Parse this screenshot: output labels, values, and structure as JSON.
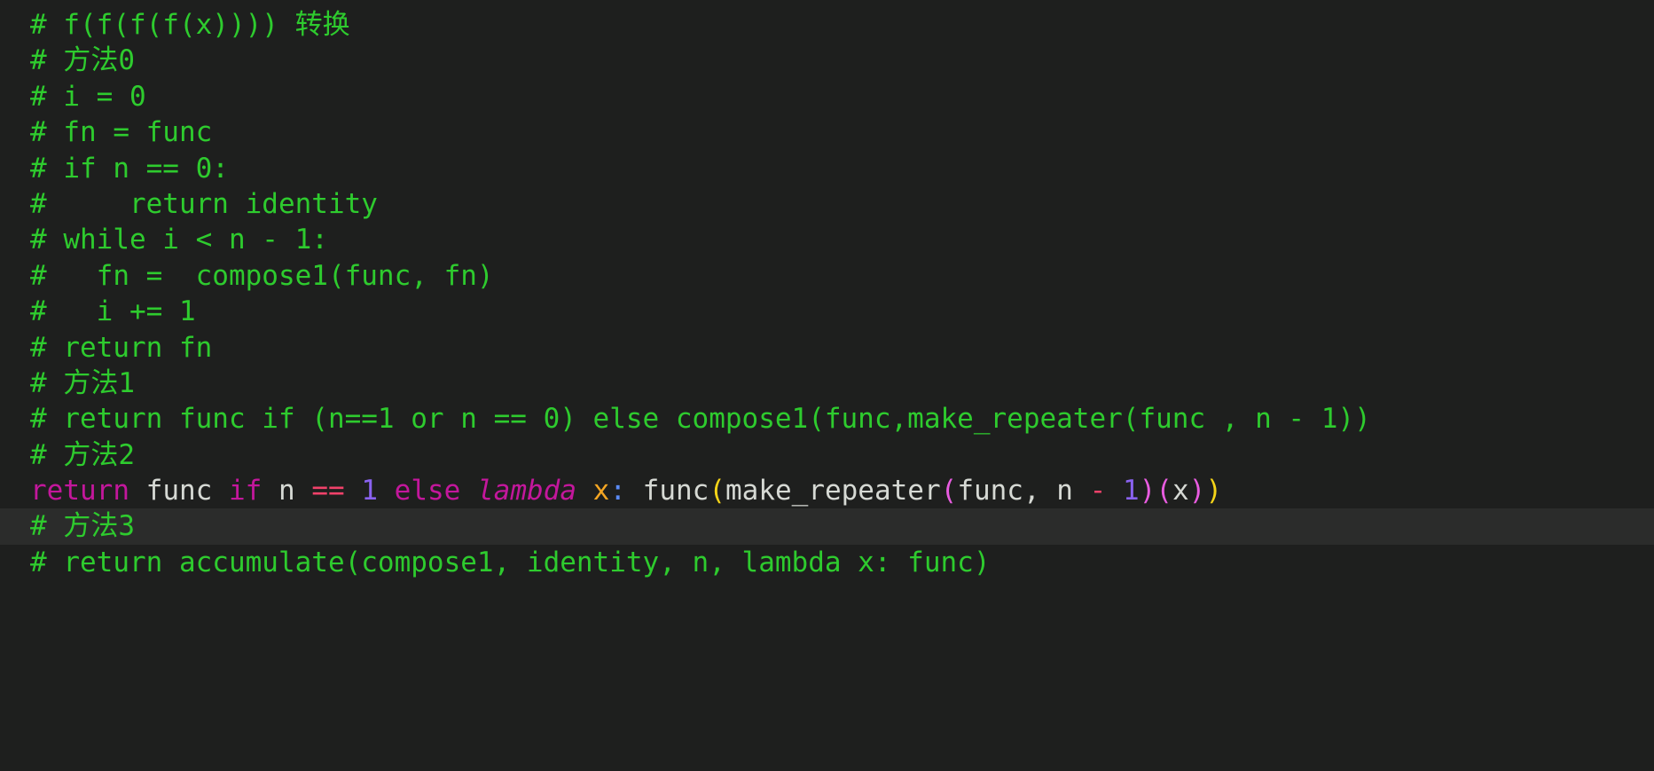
{
  "editor": {
    "background_color": "#1e1f1e",
    "active_line_color": "#2b2c2b",
    "comment_color": "#2ecb2e",
    "keyword_color": "#c3179c",
    "plain_color": "#d6d9d4",
    "operator_color": "#f1426a",
    "number_color": "#8a62f0",
    "param_color": "#f5a623",
    "colon_color": "#5b8bf7",
    "bracket_yellow": "#f5d418",
    "bracket_magenta": "#e85ce0"
  },
  "lines": [
    {
      "id": 1,
      "text": "# f(f(f(f(x)))) 转换",
      "kind": "comment",
      "active": false
    },
    {
      "id": 2,
      "text": "# 方法0",
      "kind": "comment",
      "active": false
    },
    {
      "id": 3,
      "text": "# i = 0",
      "kind": "comment",
      "active": false
    },
    {
      "id": 4,
      "text": "# fn = func",
      "kind": "comment",
      "active": false
    },
    {
      "id": 5,
      "text": "# if n == 0:",
      "kind": "comment",
      "active": false
    },
    {
      "id": 6,
      "text": "#     return identity",
      "kind": "comment",
      "active": false
    },
    {
      "id": 7,
      "text": "# while i < n - 1:",
      "kind": "comment",
      "active": false
    },
    {
      "id": 8,
      "text": "#   fn =  compose1(func, fn)",
      "kind": "comment",
      "active": false
    },
    {
      "id": 9,
      "text": "#   i += 1",
      "kind": "comment",
      "active": false
    },
    {
      "id": 10,
      "text": "# return fn",
      "kind": "comment",
      "active": false
    },
    {
      "id": 11,
      "text": "# 方法1",
      "kind": "comment",
      "active": false
    },
    {
      "id": 12,
      "text": "# return func if (n==1 or n == 0) else compose1(func,make_repeater(func , n - 1))",
      "kind": "comment",
      "active": false
    },
    {
      "id": 13,
      "text": "# 方法2",
      "kind": "comment",
      "active": false
    },
    {
      "id": 14,
      "text": "return func if n == 1 else lambda x: func(make_repeater(func, n - 1)(x))",
      "kind": "code",
      "active": false,
      "tokens": [
        {
          "text": "return",
          "type": "keyword"
        },
        {
          "text": " ",
          "type": "plain"
        },
        {
          "text": "func",
          "type": "plain"
        },
        {
          "text": " ",
          "type": "plain"
        },
        {
          "text": "if",
          "type": "keyword"
        },
        {
          "text": " ",
          "type": "plain"
        },
        {
          "text": "n",
          "type": "plain"
        },
        {
          "text": " ",
          "type": "plain"
        },
        {
          "text": "==",
          "type": "operator"
        },
        {
          "text": " ",
          "type": "plain"
        },
        {
          "text": "1",
          "type": "number"
        },
        {
          "text": " ",
          "type": "plain"
        },
        {
          "text": "else",
          "type": "keyword"
        },
        {
          "text": " ",
          "type": "plain"
        },
        {
          "text": "lambda",
          "type": "keyword-italic"
        },
        {
          "text": " ",
          "type": "plain"
        },
        {
          "text": "x",
          "type": "param"
        },
        {
          "text": ":",
          "type": "colon"
        },
        {
          "text": " ",
          "type": "plain"
        },
        {
          "text": "func",
          "type": "plain"
        },
        {
          "text": "(",
          "type": "bracket-yellow"
        },
        {
          "text": "make_repeater",
          "type": "plain"
        },
        {
          "text": "(",
          "type": "bracket-magenta"
        },
        {
          "text": "func, ",
          "type": "plain"
        },
        {
          "text": "n",
          "type": "plain"
        },
        {
          "text": " ",
          "type": "plain"
        },
        {
          "text": "-",
          "type": "operator"
        },
        {
          "text": " ",
          "type": "plain"
        },
        {
          "text": "1",
          "type": "number"
        },
        {
          "text": ")",
          "type": "bracket-magenta"
        },
        {
          "text": "(",
          "type": "bracket-magenta"
        },
        {
          "text": "x",
          "type": "plain"
        },
        {
          "text": ")",
          "type": "bracket-magenta"
        },
        {
          "text": ")",
          "type": "bracket-yellow"
        }
      ]
    },
    {
      "id": 15,
      "text": "# 方法3",
      "kind": "comment",
      "active": true
    },
    {
      "id": 16,
      "text": "# return accumulate(compose1, identity, n, lambda x: func)",
      "kind": "comment",
      "active": false
    }
  ]
}
